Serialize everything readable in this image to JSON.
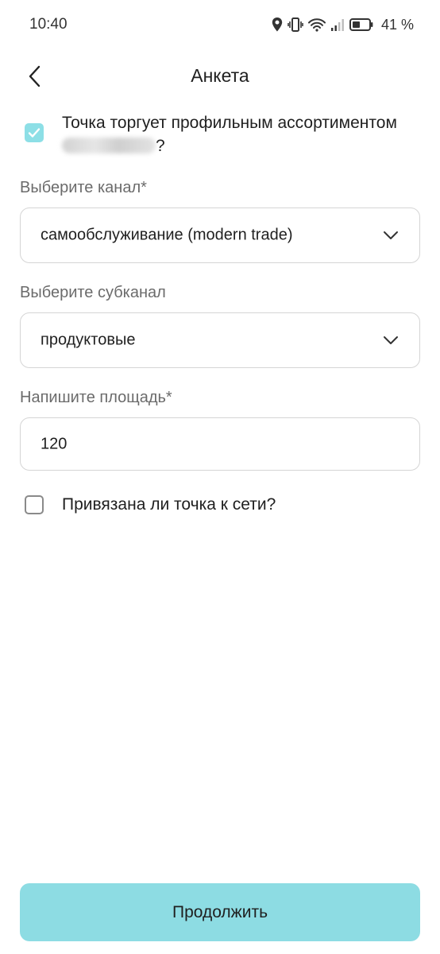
{
  "status_bar": {
    "time": "10:40",
    "battery_percent": "41 %",
    "icons": [
      "location-icon",
      "vibrate-icon",
      "wifi-icon",
      "signal-icon",
      "battery-icon"
    ]
  },
  "header": {
    "title": "Анкета",
    "back_icon": "chevron-left-icon"
  },
  "form": {
    "question_assortment": {
      "text": "Точка торгует профильным ассортиментом",
      "suffix": "?",
      "checked": true
    },
    "channel": {
      "label": "Выберите канал*",
      "value": "самообслуживание (modern trade)"
    },
    "subchannel": {
      "label": "Выберите субканал",
      "value": "продуктовые"
    },
    "area": {
      "label": "Напишите площадь*",
      "value": "120"
    },
    "question_network": {
      "text": "Привязана ли точка к сети?",
      "checked": false
    }
  },
  "footer": {
    "continue_label": "Продолжить"
  },
  "colors": {
    "accent": "#8ddce3",
    "text": "#1f1f1f",
    "label": "#6b6b6b",
    "border": "#d5d5d5"
  }
}
